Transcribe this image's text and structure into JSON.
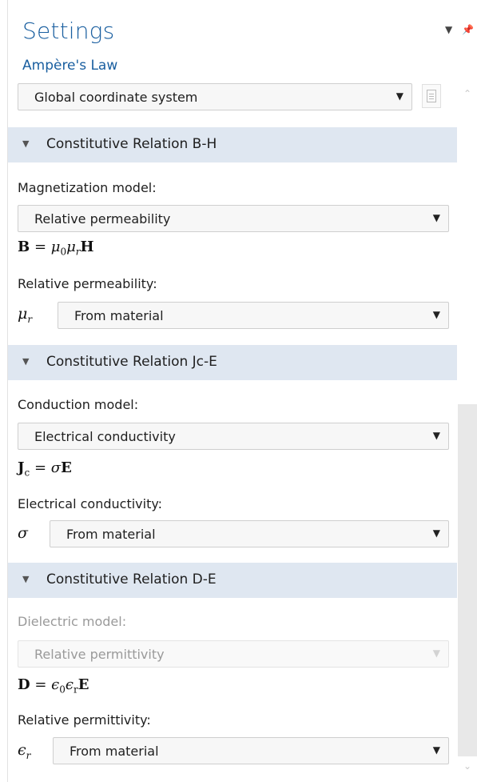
{
  "header": {
    "title": "Settings",
    "subtitle": "Ampère's Law"
  },
  "coordinate_system": {
    "value": "Global coordinate system"
  },
  "sections": {
    "bh": {
      "title": "Constitutive Relation B-H",
      "model_label": "Magnetization model:",
      "model_value": "Relative permeability",
      "formula": "B = μ0μrH",
      "param_label": "Relative permeability:",
      "param_symbol": "μr",
      "param_value": "From material"
    },
    "jce": {
      "title": "Constitutive Relation Jc-E",
      "model_label": "Conduction model:",
      "model_value": "Electrical conductivity",
      "formula": "Jc = σE",
      "param_label": "Electrical conductivity:",
      "param_symbol": "σ",
      "param_value": "From material"
    },
    "de": {
      "title": "Constitutive Relation D-E",
      "model_label": "Dielectric model:",
      "model_value": "Relative permittivity",
      "formula": "D = ε0εrE",
      "param_label": "Relative permittivity:",
      "param_symbol": "εr",
      "param_value": "From material"
    }
  },
  "icons": {
    "collapse": "triangle-down-icon",
    "dropdown": "chevron-down-icon",
    "pin": "pin-icon"
  },
  "colors": {
    "accent": "#1a5fa0",
    "section_bg": "#dfe7f1"
  }
}
